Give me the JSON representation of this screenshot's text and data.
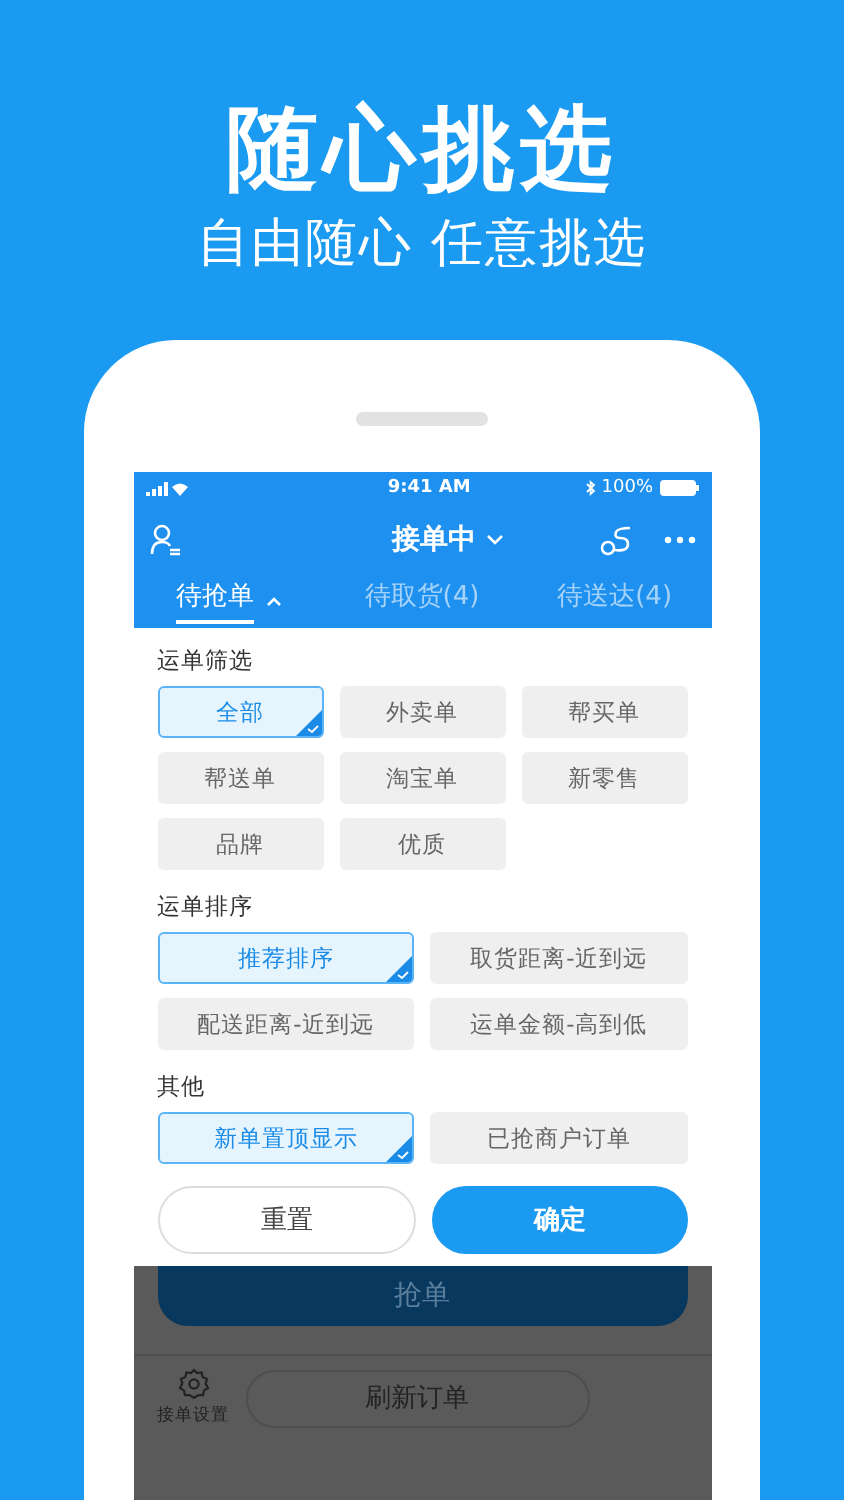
{
  "headline": "随心挑选",
  "subheadline": "自由随心 任意挑选",
  "status_bar": {
    "time": "9:41 AM",
    "battery": "100%"
  },
  "nav": {
    "title": "接单中"
  },
  "tabs": [
    {
      "label": "待抢单",
      "selected": true
    },
    {
      "label": "待取货(4)",
      "selected": false
    },
    {
      "label": "待送达(4)",
      "selected": false
    }
  ],
  "sections": [
    {
      "title": "运单筛选",
      "options": [
        {
          "label": "全部",
          "selected": true
        },
        {
          "label": "外卖单",
          "selected": false
        },
        {
          "label": "帮买单",
          "selected": false
        },
        {
          "label": "帮送单",
          "selected": false
        },
        {
          "label": "淘宝单",
          "selected": false
        },
        {
          "label": "新零售",
          "selected": false
        },
        {
          "label": "品牌",
          "selected": false
        },
        {
          "label": "优质",
          "selected": false
        }
      ]
    },
    {
      "title": "运单排序",
      "options": [
        {
          "label": "推荐排序",
          "selected": true
        },
        {
          "label": "取货距离-近到远",
          "selected": false
        },
        {
          "label": "配送距离-近到远",
          "selected": false
        },
        {
          "label": "运单金额-高到低",
          "selected": false
        }
      ]
    },
    {
      "title": "其他",
      "options": [
        {
          "label": "新单置顶显示",
          "selected": true
        },
        {
          "label": "已抢商户订单",
          "selected": false
        }
      ]
    }
  ],
  "actions": {
    "reset": "重置",
    "confirm": "确定"
  },
  "background_screen": {
    "grab_button": "抢单",
    "settings_label": "接单设置",
    "refresh_button": "刷新订单"
  }
}
